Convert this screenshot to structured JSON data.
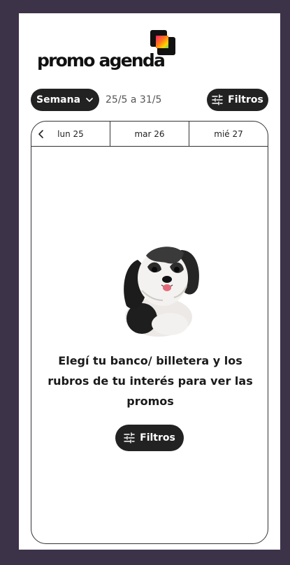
{
  "brand": {
    "logo_text": "promo agenda",
    "colors": {
      "primary_dark": "#222222",
      "background": "#3d3349",
      "surface": "#ffffff"
    }
  },
  "controls": {
    "week_select": {
      "label": "Semana",
      "icon": "chevron-down-icon"
    },
    "date_range": "25/5 a 31/5",
    "filters_button": {
      "label": "Filtros",
      "icon": "sliders-icon"
    }
  },
  "calendar": {
    "prev_icon": "chevron-left-icon",
    "days": [
      {
        "label": "lun 25"
      },
      {
        "label": "mar 26"
      },
      {
        "label": "mié 27"
      }
    ]
  },
  "empty_state": {
    "illustration": "dog-illustration",
    "message": "Elegí tu banco/ billetera y los rubros de tu interés para ver las promos",
    "filters_button": {
      "label": "Filtros",
      "icon": "sliders-icon"
    }
  }
}
